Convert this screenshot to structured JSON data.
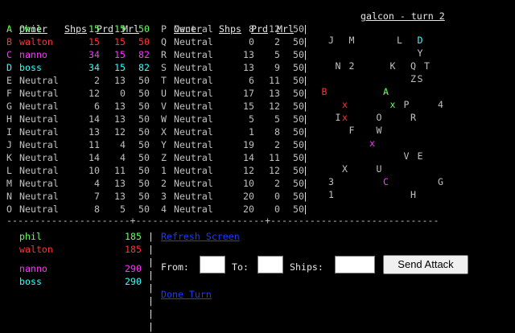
{
  "colors": {
    "phil": "#66ff66",
    "walton": "#ff3333",
    "nanno": "#ff33ff",
    "boss": "#33ffff",
    "neutral": "#c0c0c0",
    "link": "#1a3cff"
  },
  "table_headers": {
    "owner": "Owner",
    "ships": "Shps",
    "prod": "Prd",
    "morale": "Mrl"
  },
  "left_planets": [
    {
      "id": "A",
      "owner": "phil",
      "ships": "15",
      "prod": "15",
      "morale": "50",
      "color": "#66ff66"
    },
    {
      "id": "B",
      "owner": "walton",
      "ships": "15",
      "prod": "15",
      "morale": "50",
      "color": "#ff3333"
    },
    {
      "id": "C",
      "owner": "nanno",
      "ships": "34",
      "prod": "15",
      "morale": "82",
      "color": "#ff33ff"
    },
    {
      "id": "D",
      "owner": "boss",
      "ships": "34",
      "prod": "15",
      "morale": "82",
      "color": "#33ffff"
    },
    {
      "id": "E",
      "owner": "Neutral",
      "ships": "2",
      "prod": "13",
      "morale": "50",
      "color": "#c0c0c0"
    },
    {
      "id": "F",
      "owner": "Neutral",
      "ships": "12",
      "prod": "0",
      "morale": "50",
      "color": "#c0c0c0"
    },
    {
      "id": "G",
      "owner": "Neutral",
      "ships": "6",
      "prod": "13",
      "morale": "50",
      "color": "#c0c0c0"
    },
    {
      "id": "H",
      "owner": "Neutral",
      "ships": "14",
      "prod": "13",
      "morale": "50",
      "color": "#c0c0c0"
    },
    {
      "id": "I",
      "owner": "Neutral",
      "ships": "13",
      "prod": "12",
      "morale": "50",
      "color": "#c0c0c0"
    },
    {
      "id": "J",
      "owner": "Neutral",
      "ships": "11",
      "prod": "4",
      "morale": "50",
      "color": "#c0c0c0"
    },
    {
      "id": "K",
      "owner": "Neutral",
      "ships": "14",
      "prod": "4",
      "morale": "50",
      "color": "#c0c0c0"
    },
    {
      "id": "L",
      "owner": "Neutral",
      "ships": "10",
      "prod": "11",
      "morale": "50",
      "color": "#c0c0c0"
    },
    {
      "id": "M",
      "owner": "Neutral",
      "ships": "4",
      "prod": "13",
      "morale": "50",
      "color": "#c0c0c0"
    },
    {
      "id": "N",
      "owner": "Neutral",
      "ships": "7",
      "prod": "13",
      "morale": "50",
      "color": "#c0c0c0"
    },
    {
      "id": "O",
      "owner": "Neutral",
      "ships": "8",
      "prod": "5",
      "morale": "50",
      "color": "#c0c0c0"
    }
  ],
  "right_planets": [
    {
      "id": "P",
      "owner": "Neutral",
      "ships": "8",
      "prod": "12",
      "morale": "50",
      "color": "#c0c0c0"
    },
    {
      "id": "Q",
      "owner": "Neutral",
      "ships": "0",
      "prod": "2",
      "morale": "50",
      "color": "#c0c0c0"
    },
    {
      "id": "R",
      "owner": "Neutral",
      "ships": "13",
      "prod": "5",
      "morale": "50",
      "color": "#c0c0c0"
    },
    {
      "id": "S",
      "owner": "Neutral",
      "ships": "13",
      "prod": "9",
      "morale": "50",
      "color": "#c0c0c0"
    },
    {
      "id": "T",
      "owner": "Neutral",
      "ships": "6",
      "prod": "11",
      "morale": "50",
      "color": "#c0c0c0"
    },
    {
      "id": "U",
      "owner": "Neutral",
      "ships": "17",
      "prod": "13",
      "morale": "50",
      "color": "#c0c0c0"
    },
    {
      "id": "V",
      "owner": "Neutral",
      "ships": "15",
      "prod": "12",
      "morale": "50",
      "color": "#c0c0c0"
    },
    {
      "id": "W",
      "owner": "Neutral",
      "ships": "5",
      "prod": "5",
      "morale": "50",
      "color": "#c0c0c0"
    },
    {
      "id": "X",
      "owner": "Neutral",
      "ships": "1",
      "prod": "8",
      "morale": "50",
      "color": "#c0c0c0"
    },
    {
      "id": "Y",
      "owner": "Neutral",
      "ships": "19",
      "prod": "2",
      "morale": "50",
      "color": "#c0c0c0"
    },
    {
      "id": "Z",
      "owner": "Neutral",
      "ships": "14",
      "prod": "11",
      "morale": "50",
      "color": "#c0c0c0"
    },
    {
      "id": "1",
      "owner": "Neutral",
      "ships": "12",
      "prod": "12",
      "morale": "50",
      "color": "#c0c0c0"
    },
    {
      "id": "2",
      "owner": "Neutral",
      "ships": "10",
      "prod": "2",
      "morale": "50",
      "color": "#c0c0c0"
    },
    {
      "id": "3",
      "owner": "Neutral",
      "ships": "20",
      "prod": "0",
      "morale": "50",
      "color": "#c0c0c0"
    },
    {
      "id": "4",
      "owner": "Neutral",
      "ships": "20",
      "prod": "0",
      "morale": "50",
      "color": "#c0c0c0"
    }
  ],
  "map": {
    "title": "galcon - turn 2",
    "grid_cols": 19,
    "grid_rows": 16,
    "glyphs": [
      {
        "ch": "J",
        "col": 0,
        "row": 0,
        "color": "#c0c0c0"
      },
      {
        "ch": "M",
        "col": 3,
        "row": 0,
        "color": "#c0c0c0"
      },
      {
        "ch": "L",
        "col": 10,
        "row": 0,
        "color": "#c0c0c0"
      },
      {
        "ch": "D",
        "col": 13,
        "row": 0,
        "color": "#33ffff"
      },
      {
        "ch": "Y",
        "col": 13,
        "row": 1,
        "color": "#c0c0c0"
      },
      {
        "ch": "N",
        "col": 1,
        "row": 2,
        "color": "#c0c0c0"
      },
      {
        "ch": "2",
        "col": 3,
        "row": 2,
        "color": "#c0c0c0"
      },
      {
        "ch": "K",
        "col": 9,
        "row": 2,
        "color": "#c0c0c0"
      },
      {
        "ch": "Q",
        "col": 12,
        "row": 2,
        "color": "#c0c0c0"
      },
      {
        "ch": "T",
        "col": 14,
        "row": 2,
        "color": "#c0c0c0"
      },
      {
        "ch": "Z",
        "col": 12,
        "row": 3,
        "color": "#c0c0c0"
      },
      {
        "ch": "S",
        "col": 13,
        "row": 3,
        "color": "#c0c0c0"
      },
      {
        "ch": "B",
        "col": -1,
        "row": 4,
        "color": "#ff3333"
      },
      {
        "ch": "A",
        "col": 8,
        "row": 4,
        "color": "#66ff66"
      },
      {
        "ch": "x",
        "col": 2,
        "row": 5,
        "color": "#ff3333"
      },
      {
        "ch": "x",
        "col": 9,
        "row": 5,
        "color": "#66ff66"
      },
      {
        "ch": "P",
        "col": 11,
        "row": 5,
        "color": "#c0c0c0"
      },
      {
        "ch": "4",
        "col": 16,
        "row": 5,
        "color": "#c0c0c0"
      },
      {
        "ch": "I",
        "col": 1,
        "row": 6,
        "color": "#c0c0c0"
      },
      {
        "ch": "x",
        "col": 2,
        "row": 6,
        "color": "#ff3333"
      },
      {
        "ch": "O",
        "col": 7,
        "row": 6,
        "color": "#c0c0c0"
      },
      {
        "ch": "R",
        "col": 12,
        "row": 6,
        "color": "#c0c0c0"
      },
      {
        "ch": "F",
        "col": 3,
        "row": 7,
        "color": "#c0c0c0"
      },
      {
        "ch": "W",
        "col": 7,
        "row": 7,
        "color": "#c0c0c0"
      },
      {
        "ch": "x",
        "col": 6,
        "row": 8,
        "color": "#ff33ff"
      },
      {
        "ch": "V",
        "col": 11,
        "row": 9,
        "color": "#c0c0c0"
      },
      {
        "ch": "E",
        "col": 13,
        "row": 9,
        "color": "#c0c0c0"
      },
      {
        "ch": "X",
        "col": 2,
        "row": 10,
        "color": "#c0c0c0"
      },
      {
        "ch": "U",
        "col": 7,
        "row": 10,
        "color": "#c0c0c0"
      },
      {
        "ch": "3",
        "col": 0,
        "row": 11,
        "color": "#c0c0c0"
      },
      {
        "ch": "C",
        "col": 8,
        "row": 11,
        "color": "#ff33ff"
      },
      {
        "ch": "G",
        "col": 16,
        "row": 11,
        "color": "#c0c0c0"
      },
      {
        "ch": "1",
        "col": 0,
        "row": 12,
        "color": "#c0c0c0"
      },
      {
        "ch": "H",
        "col": 12,
        "row": 12,
        "color": "#c0c0c0"
      }
    ]
  },
  "scores": [
    {
      "name": "phil",
      "value": "185",
      "color": "#66ff66"
    },
    {
      "name": "walton",
      "value": "185",
      "color": "#ff3333"
    },
    {
      "name": "nanno",
      "value": "290",
      "color": "#ff33ff"
    },
    {
      "name": "boss",
      "value": "290",
      "color": "#33ffff"
    }
  ],
  "actions": {
    "refresh_label": "Refresh Screen",
    "from_label": "From:",
    "to_label": "To:",
    "ships_label": "Ships:",
    "send_label": "Send Attack",
    "done_label": "Done Turn",
    "from_value": "",
    "to_value": "",
    "ships_value": ""
  }
}
